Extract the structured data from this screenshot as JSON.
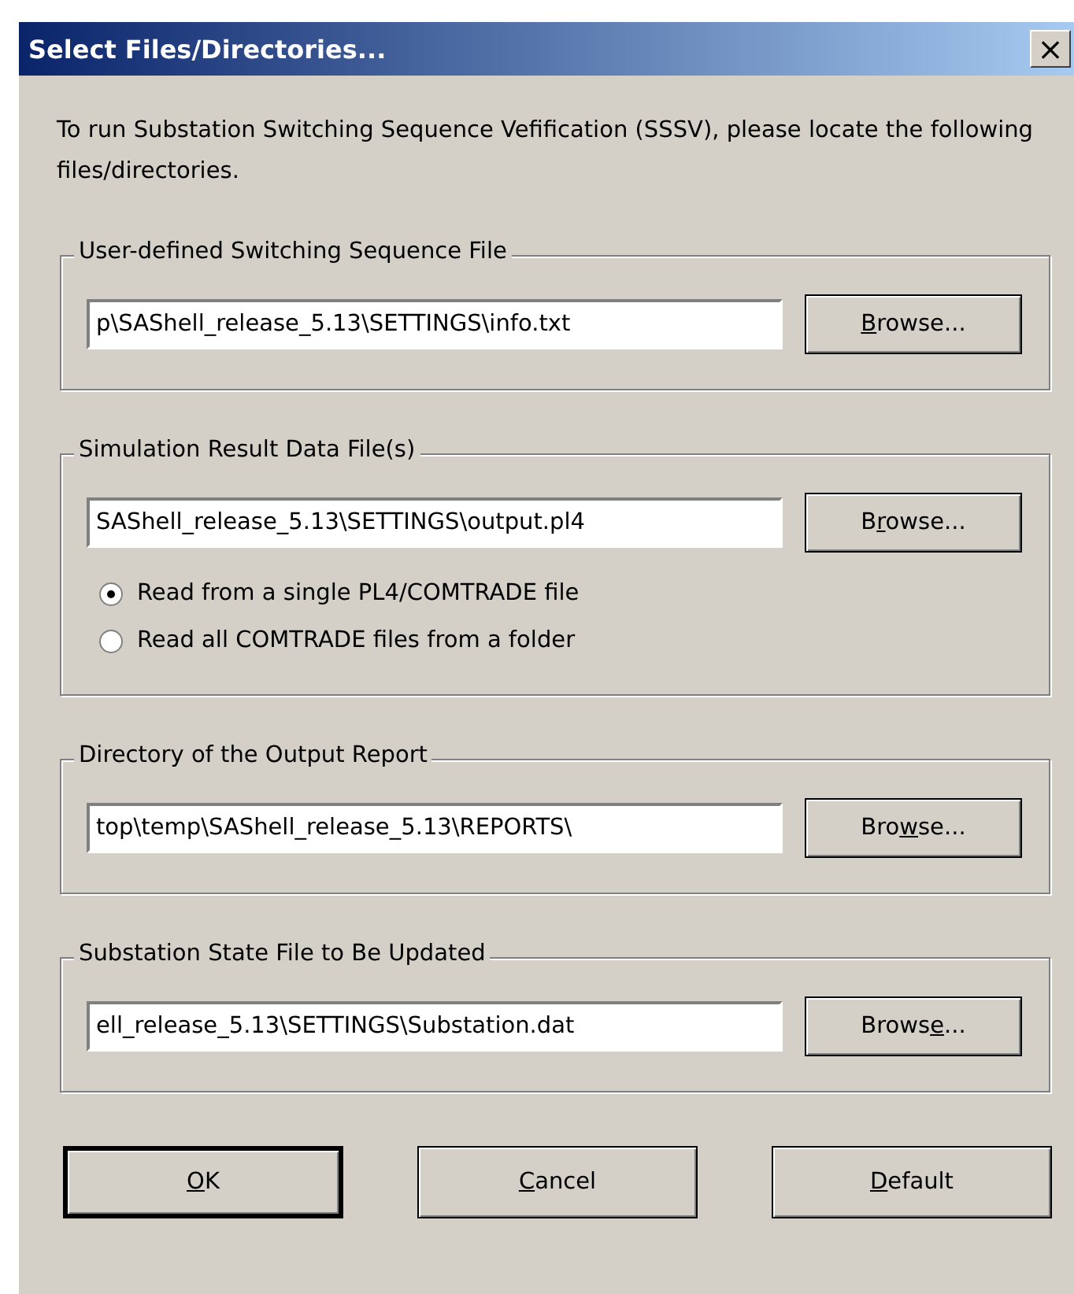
{
  "window": {
    "title": "Select Files/Directories...",
    "close": "×"
  },
  "intro": "To run Substation Switching Sequence Vefification (SSSV), please locate the following files/directories.",
  "groups": [
    {
      "title": "User-defined Switching Sequence File",
      "value": "p\\SAShell_release_5.13\\SETTINGS\\info.txt",
      "browse": {
        "key": "B",
        "after": "rowse..."
      }
    },
    {
      "title": "Simulation Result Data File(s)",
      "value": "SAShell_release_5.13\\SETTINGS\\output.pl4",
      "browse": {
        "before": "B",
        "key": "r",
        "after": "owse..."
      },
      "options": [
        {
          "label": "Read from a single PL4/COMTRADE file",
          "selected": true
        },
        {
          "label": "Read all COMTRADE files from a folder",
          "selected": false
        }
      ]
    },
    {
      "title": "Directory of the Output Report",
      "value": "top\\temp\\SAShell_release_5.13\\REPORTS\\",
      "browse": {
        "before": "Bro",
        "key": "w",
        "after": "se..."
      }
    },
    {
      "title": "Substation State File to Be Updated",
      "value": "ell_release_5.13\\SETTINGS\\Substation.dat",
      "browse": {
        "before": "Brows",
        "key": "e",
        "after": "..."
      }
    }
  ],
  "buttons": [
    {
      "key": "O",
      "after": "K",
      "default": true
    },
    {
      "key": "C",
      "after": "ancel",
      "default": false
    },
    {
      "key": "D",
      "after": "efault",
      "default": false
    }
  ]
}
